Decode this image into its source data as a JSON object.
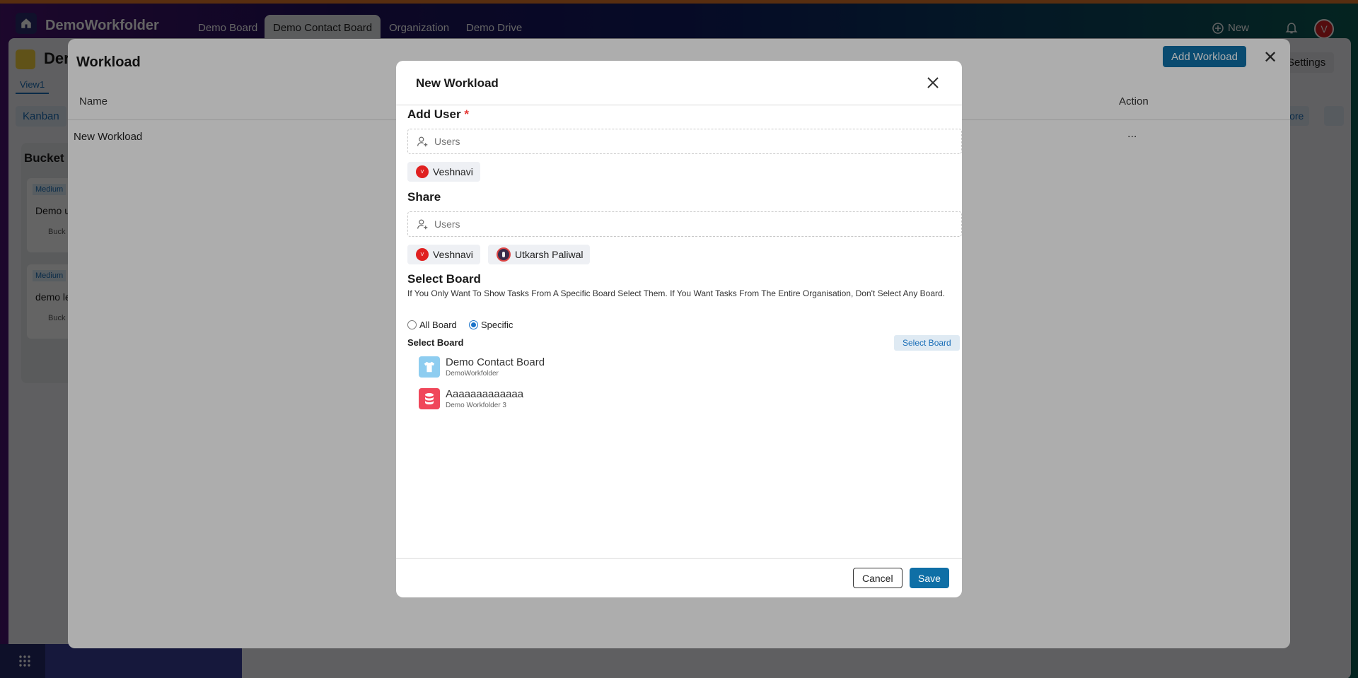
{
  "app": {
    "name": "DemoWorkfolder",
    "nav_tabs": [
      "Demo Board",
      "Demo Contact Board",
      "Organization",
      "Demo Drive"
    ],
    "new_label": "New",
    "avatar_initial": "V"
  },
  "background_board": {
    "title_fragment": "Der",
    "view_tab": "View1",
    "kanban_label": "Kanban",
    "settings_label": "Settings",
    "more_label": "lore",
    "bucket_title": "Bucket",
    "cards": [
      {
        "badge": "Medium",
        "text": "Demo u",
        "bucket": "Buck"
      },
      {
        "badge": "Medium",
        "text": "demo le",
        "bucket": "Buck"
      }
    ]
  },
  "workload_panel": {
    "title": "Workload",
    "add_button": "Add Workload",
    "columns": {
      "name": "Name",
      "action": "Action"
    },
    "rows": [
      {
        "name": "New Workload",
        "action": "..."
      }
    ]
  },
  "modal": {
    "title": "New Workload",
    "add_user": {
      "label": "Add User",
      "required_mark": "*",
      "placeholder": "Users",
      "chips": [
        {
          "name": "Veshnavi",
          "avatar": "V"
        }
      ]
    },
    "share": {
      "label": "Share",
      "placeholder": "Users",
      "chips": [
        {
          "name": "Veshnavi",
          "avatar": "V"
        },
        {
          "name": "Utkarsh Paliwal",
          "avatar": "U"
        }
      ]
    },
    "select_board": {
      "heading": "Select Board",
      "description": "If You Only Want To Show Tasks From A Specific Board Select Them. If You Want Tasks From The Entire Organisation, Don't Select Any Board.",
      "radio_options": [
        {
          "label": "All Board",
          "selected": false
        },
        {
          "label": "Specific",
          "selected": true
        }
      ],
      "list_label": "Select Board",
      "select_button": "Select Board",
      "boards": [
        {
          "name": "Demo Contact Board",
          "org": "DemoWorkfolder",
          "icon": "shirt-icon",
          "color": "#8ecdf0"
        },
        {
          "name": "Aaaaaaaaaaaaa",
          "org": "Demo Workfolder 3",
          "icon": "database-icon",
          "color": "#f0475a"
        }
      ]
    },
    "cancel_label": "Cancel",
    "save_label": "Save"
  },
  "colors": {
    "primary": "#0f6fa6",
    "required": "#e53935",
    "avatar_red": "#d81f26",
    "backdrop_orange": "#e0782a"
  }
}
